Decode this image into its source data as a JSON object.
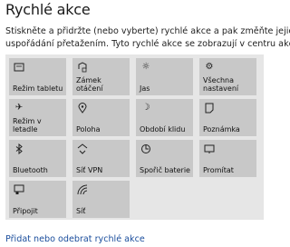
{
  "title": "Rychlé akce",
  "description_line1": "Stiskněte a přidržte (nebo vyberte) rychlé akce a pak změňte jejich",
  "description_line2": "uspořádání přetažením. Tyto rychlé akce se zobrazují v centru akcí.",
  "tiles": [
    {
      "label": "Režim tabletu",
      "icon": "tablet-mode-icon"
    },
    {
      "label": "Zámek otáčení",
      "icon": "rotation-lock-icon"
    },
    {
      "label": "Jas",
      "icon": "brightness-icon"
    },
    {
      "label": "Všechna\nnastavení",
      "icon": "settings-gear-icon"
    },
    {
      "label": "Režim v\nletadle",
      "icon": "airplane-icon"
    },
    {
      "label": "Poloha",
      "icon": "location-icon"
    },
    {
      "label": "Období klidu",
      "icon": "moon-icon"
    },
    {
      "label": "Poznámka",
      "icon": "note-icon"
    },
    {
      "label": "Bluetooth",
      "icon": "bluetooth-icon"
    },
    {
      "label": "Síť VPN",
      "icon": "vpn-icon"
    },
    {
      "label": "Spořič baterie",
      "icon": "battery-saver-icon"
    },
    {
      "label": "Promítat",
      "icon": "project-icon"
    },
    {
      "label": "Připojit",
      "icon": "connect-icon"
    },
    {
      "label": "Síť",
      "icon": "network-icon"
    }
  ],
  "link_label": "Přidat nebo odebrat rychlé akce",
  "colors": {
    "tile": "#c8c8c8",
    "panel": "#e6e6e6",
    "link": "#1a4d9c"
  }
}
